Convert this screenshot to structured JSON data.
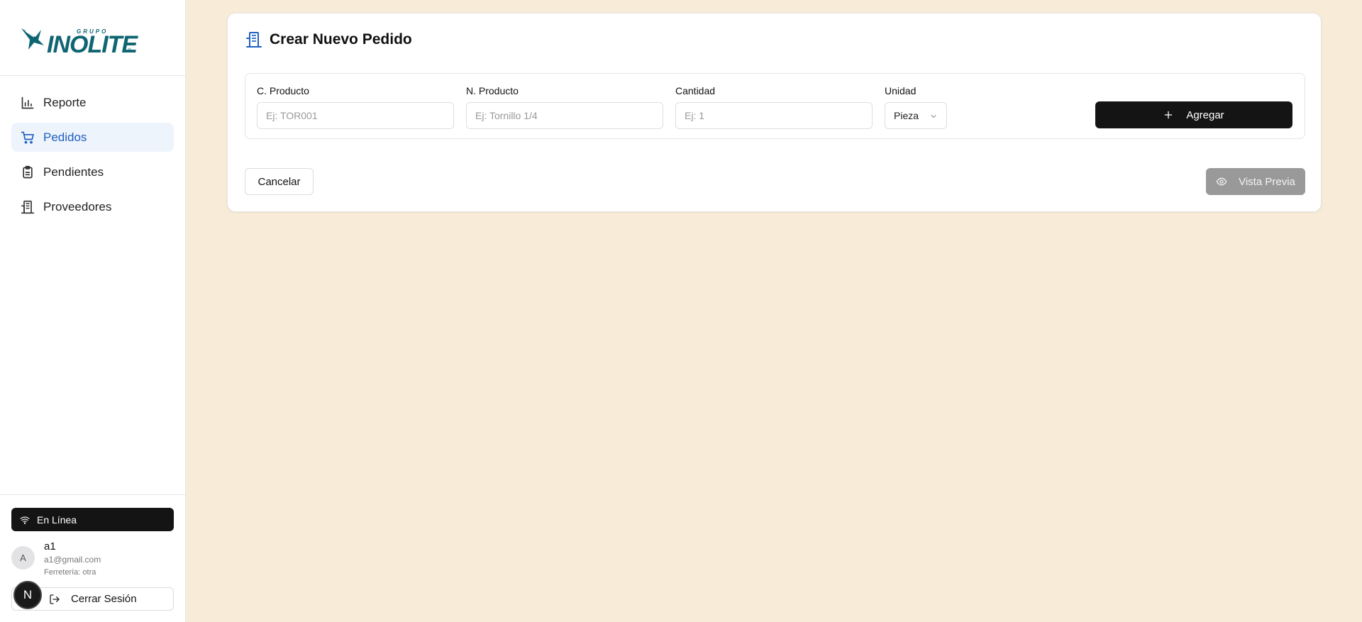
{
  "brand": {
    "group": "GRUPO",
    "name": "INOLITE",
    "reg": "®"
  },
  "sidebar": {
    "items": [
      {
        "label": "Reporte",
        "icon": "bar-chart-icon",
        "active": false
      },
      {
        "label": "Pedidos",
        "icon": "cart-icon",
        "active": true
      },
      {
        "label": "Pendientes",
        "icon": "clipboard-icon",
        "active": false
      },
      {
        "label": "Proveedores",
        "icon": "building-icon",
        "active": false
      }
    ]
  },
  "status": {
    "label": "En Línea"
  },
  "user": {
    "initial": "A",
    "name": "a1",
    "email": "a1@gmail.com",
    "store": "Ferretería: otra"
  },
  "logout_label": "Cerrar Sesión",
  "dev_badge": "N",
  "order_form": {
    "title": "Crear Nuevo Pedido",
    "fields": {
      "code": {
        "label": "C. Producto",
        "placeholder": "Ej: TOR001"
      },
      "name": {
        "label": "N. Producto",
        "placeholder": "Ej: Tornillo 1/4"
      },
      "qty": {
        "label": "Cantidad",
        "placeholder": "Ej: 1"
      },
      "unit": {
        "label": "Unidad",
        "value": "Pieza"
      }
    },
    "add_label": "Agregar",
    "cancel_label": "Cancelar",
    "preview_label": "Vista Previa"
  },
  "colors": {
    "background": "#f8ecd8",
    "accent": "#1f5fbf",
    "brand": "#0f6572",
    "dark_button": "#141414",
    "disabled_button": "#999999"
  }
}
